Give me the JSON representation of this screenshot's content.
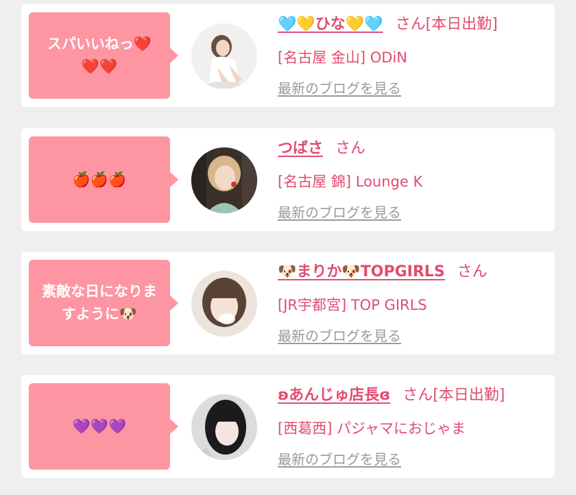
{
  "posts": [
    {
      "comment": "スパいいねっ❤️❤️❤️",
      "name": "🩵💛ひな💛🩵",
      "san": "さん",
      "status": "[本日出勤]",
      "shop": "[名古屋 金山] ODiN",
      "blog_link": "最新のブログを見る"
    },
    {
      "comment": "🍎🍎🍎",
      "name": "つばさ",
      "san": "さん",
      "status": "",
      "shop": "[名古屋 錦] Lounge K",
      "blog_link": "最新のブログを見る"
    },
    {
      "comment": "素敵な日になりますように🐶",
      "name": "🐶まりか🐶TOPGIRLS",
      "san": "さん",
      "status": "",
      "shop": "[JR宇都宮] TOP GIRLS",
      "blog_link": "最新のブログを見る"
    },
    {
      "comment": "💜💜💜",
      "name": "ʚあんじゅ店長ɞ",
      "san": "さん",
      "status": "[本日出勤]",
      "shop": "[西葛西] パジャマにおじゃま",
      "blog_link": "最新のブログを見る"
    }
  ],
  "colors": {
    "accent": "#e04c6f",
    "bubble": "#fd95a2",
    "link_gray": "#9a9a9a",
    "page_bg": "#efefef"
  }
}
